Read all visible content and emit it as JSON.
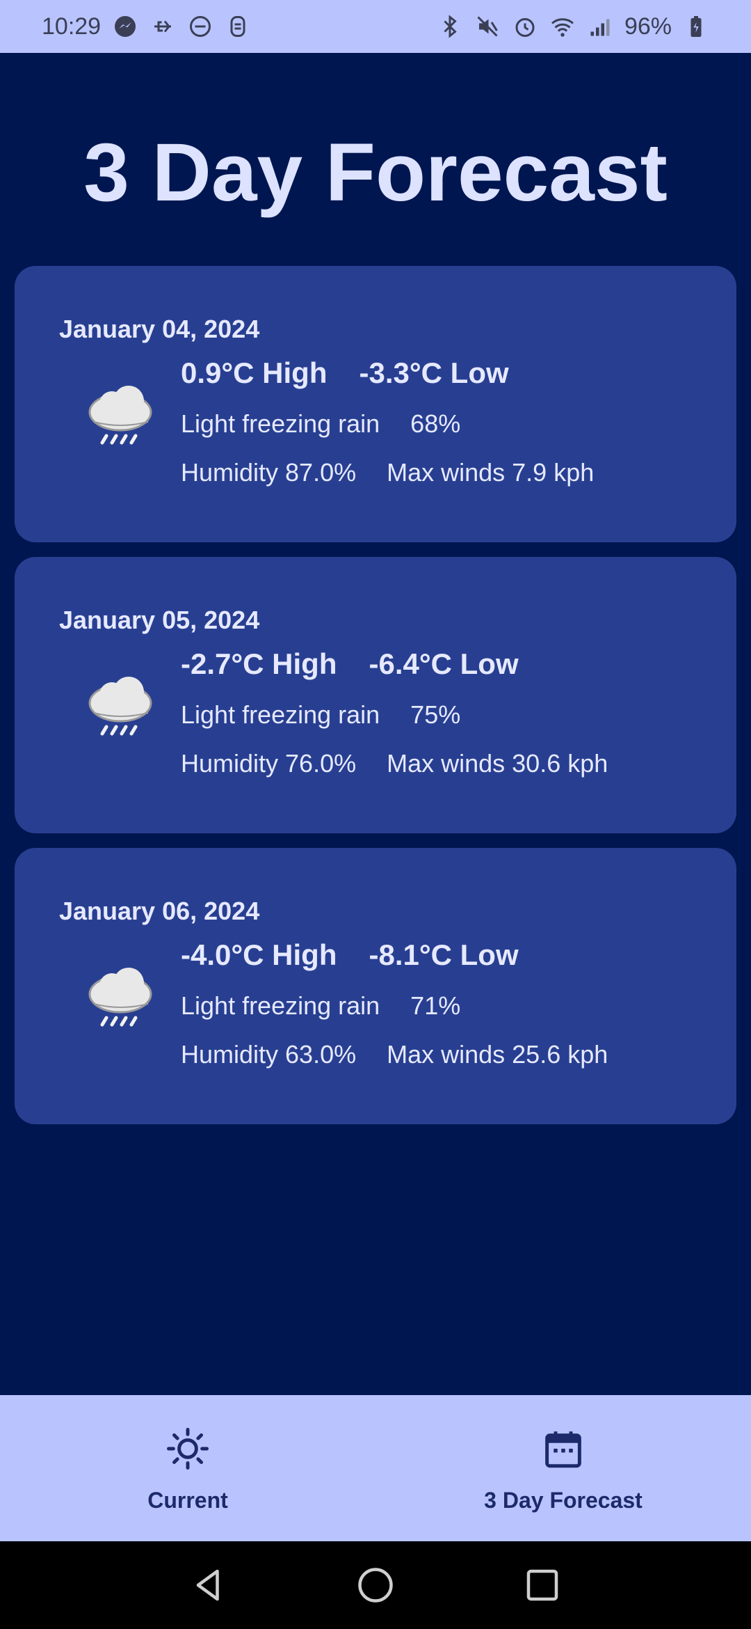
{
  "status_bar": {
    "time": "10:29",
    "battery": "96%",
    "left_icons": [
      "messenger-icon",
      "usb-icon",
      "dnd-icon",
      "app-notification-icon"
    ],
    "right_icons": [
      "bluetooth-icon",
      "mute-icon",
      "alarm-icon",
      "wifi-icon",
      "signal-icon",
      "battery-icon"
    ]
  },
  "page": {
    "title": "3 Day Forecast"
  },
  "forecast": [
    {
      "date": "January 04, 2024",
      "high": "0.9°C High",
      "low": "-3.3°C Low",
      "condition": "Light freezing rain",
      "chance": "68%",
      "humidity": "Humidity 87.0%",
      "wind": "Max winds 7.9 kph",
      "icon": "freezing-rain-cloud-icon"
    },
    {
      "date": "January 05, 2024",
      "high": "-2.7°C High",
      "low": "-6.4°C Low",
      "condition": "Light freezing rain",
      "chance": "75%",
      "humidity": "Humidity 76.0%",
      "wind": "Max winds 30.6 kph",
      "icon": "freezing-rain-cloud-icon"
    },
    {
      "date": "January 06, 2024",
      "high": "-4.0°C High",
      "low": "-8.1°C Low",
      "condition": "Light freezing rain",
      "chance": "71%",
      "humidity": "Humidity 63.0%",
      "wind": "Max winds 25.6 kph",
      "icon": "freezing-rain-cloud-icon"
    }
  ],
  "bottom_nav": {
    "items": [
      {
        "label": "Current",
        "icon": "sun-icon"
      },
      {
        "label": "3 Day Forecast",
        "icon": "calendar-icon"
      }
    ]
  },
  "colors": {
    "background": "#001650",
    "card": "#283f91",
    "nav": "#b9c4ff",
    "title": "#dde2ff"
  }
}
